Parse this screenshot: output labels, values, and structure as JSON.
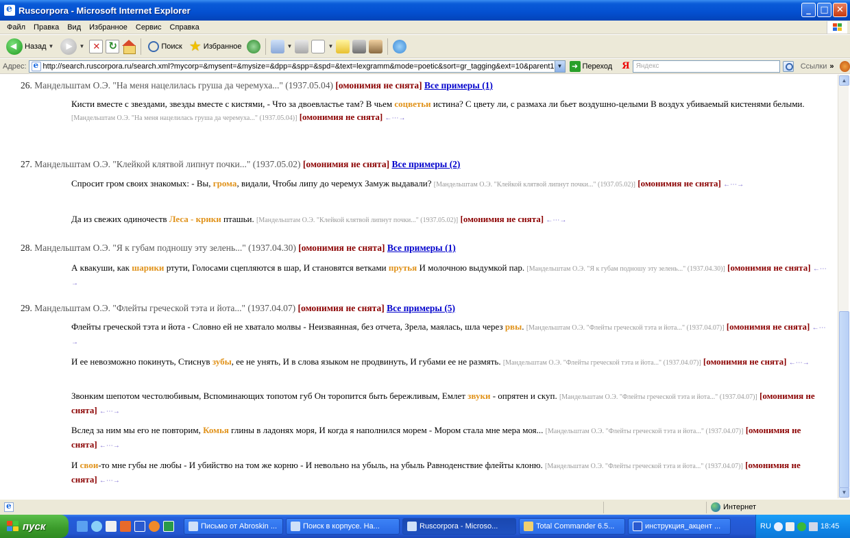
{
  "window": {
    "title": "Ruscorpora - Microsoft Internet Explorer"
  },
  "menu": [
    "Файл",
    "Правка",
    "Вид",
    "Избранное",
    "Сервис",
    "Справка"
  ],
  "toolbar": {
    "back_label": "Назад",
    "search_label": "Поиск",
    "favorites_label": "Избранное"
  },
  "address": {
    "label": "Адрес:",
    "url": "http://search.ruscorpora.ru/search.xml?mycorp=&mysent=&mysize=&dpp=&spp=&spd=&text=lexgramm&mode=poetic&sort=gr_tagging&ext=10&parent1",
    "go_label": "Переход",
    "yandex_logo": "Я",
    "yandex_placeholder": "Яндекс",
    "links_label": "Ссылки"
  },
  "entries": [
    {
      "num": "26.",
      "title": "Мандельштам О.Э. \"На меня нацелилась груша да черемуха...\" (1937.05.04)",
      "omonimia": "[омонимия не снята]",
      "all_examples": "Все примеры (1)",
      "examples": [
        {
          "before": "Кисти вместе с звездами, звезды вместе с кистями, - Что за двоевластье там? В чьем ",
          "hl": "соцветьи",
          "after": " истина? С цвету ли, с размаха ли бьет воздушно-целыми В воздух убиваемый кистенями белыми.",
          "ref": "[Мандельштам О.Э. \"На меня нацелилась груша да черемуха...\" (1937.05.04)]",
          "omonimia": "[омонимия не снята]",
          "arrows": "←⋯→"
        }
      ]
    },
    {
      "num": "27.",
      "title": "Мандельштам О.Э. \"Клейкой клятвой липнут почки...\" (1937.05.02)",
      "omonimia": "[омонимия не снята]",
      "all_examples": "Все примеры (2)",
      "examples": [
        {
          "before": "Спросит гром своих знакомых: - Вы, ",
          "hl": "грома",
          "after": ", видали, Чтобы липу до черемух Замуж выдавали?",
          "ref": "[Мандельштам О.Э. \"Клейкой клятвой липнут почки...\" (1937.05.02)]",
          "omonimia": "[омонимия не снята]",
          "arrows": "←⋯→"
        },
        {
          "before": "Да из свежих одиночеств ",
          "hl": "Леса - крики",
          "after": " пташьи.",
          "ref": "[Мандельштам О.Э. \"Клейкой клятвой липнут почки...\" (1937.05.02)]",
          "omonimia": "[омонимия не снята]",
          "arrows": "←⋯→"
        }
      ]
    },
    {
      "num": "28.",
      "title": "Мандельштам О.Э. \"Я к губам подношу эту зелень...\" (1937.04.30)",
      "omonimia": "[омонимия не снята]",
      "all_examples": "Все примеры (1)",
      "examples": [
        {
          "before": "А квакуши, как ",
          "hl": "шарики",
          "after": " ртути, Голосами сцепляются в шар, И становятся ветками ",
          "hl2": "прутья",
          "after2": " И молочною выдумкой пар.",
          "ref": "[Мандельштам О.Э. \"Я к губам подношу эту зелень...\" (1937.04.30)]",
          "omonimia": "[омонимия не снята]",
          "arrows": "←⋯→"
        }
      ]
    },
    {
      "num": "29.",
      "title": "Мандельштам О.Э. \"Флейты греческой тэта и йота...\" (1937.04.07)",
      "omonimia": "[омонимия не снята]",
      "all_examples": "Все примеры (5)",
      "examples": [
        {
          "before": "Флейты греческой тэта и йота - Словно ей не хватало молвы - Неизваянная, без отчета, Зрела, маялась, шла через ",
          "hl": "рвы",
          "after": ".",
          "ref": "[Мандельштам О.Э. \"Флейты греческой тэта и йота...\" (1937.04.07)]",
          "omonimia": "[омонимия не снята]",
          "arrows": "←⋯→"
        },
        {
          "before": "И ее невозможно покинуть, Стиснув ",
          "hl": "зубы",
          "after": ", ее не унять, И в слова языком не продвинуть, И губами ее не размять.",
          "ref": "[Мандельштам О.Э. \"Флейты греческой тэта и йота...\" (1937.04.07)]",
          "omonimia": "[омонимия не снята]",
          "arrows": "←⋯→"
        },
        {
          "before": "Звонким шепотом честолюбивым, Вспоминающих топотом губ Он торопится быть бережливым, Емлет ",
          "hl": "звуки",
          "after": " - опрятен и скуп.",
          "ref": "[Мандельштам О.Э. \"Флейты греческой тэта и йота...\" (1937.04.07)]",
          "omonimia": "[омонимия не снята]",
          "arrows": "←⋯→"
        },
        {
          "before": "Вслед за ним мы его не повторим, ",
          "hl": "Комья",
          "after": " глины в ладонях моря, И когда я наполнился морем - Мором стала мне мера моя...",
          "ref": "[Мандельштам О.Э. \"Флейты греческой тэта и йота...\" (1937.04.07)]",
          "omonimia": "[омонимия не снята]",
          "arrows": "←⋯→"
        },
        {
          "before": "И ",
          "hl": "свои",
          "after": "-то мне губы не любы - И убийство на том же корню - И невольно на убыль, на убыль Равноденствие флейты клоню.",
          "ref": "[Мандельштам О.Э. \"Флейты греческой тэта и йота...\" (1937.04.07)]",
          "omonimia": "[омонимия не снята]",
          "arrows": "←⋯→"
        }
      ]
    }
  ],
  "status": {
    "zone": "Интернет"
  },
  "taskbar": {
    "start_label": "пуск",
    "tasks": [
      "Письмо от Abroskin ...",
      "Поиск в корпусе. На...",
      "Ruscorpora - Microso...",
      "Total Commander 6.5...",
      "инструкция_акцент ..."
    ],
    "active_task_index": 2,
    "lang": "RU",
    "clock": "18:45"
  },
  "colors": {
    "highlight": "#e0921a",
    "omonimia": "#8b0000",
    "link": "#0000cc",
    "titlebar": "#0450d0"
  }
}
